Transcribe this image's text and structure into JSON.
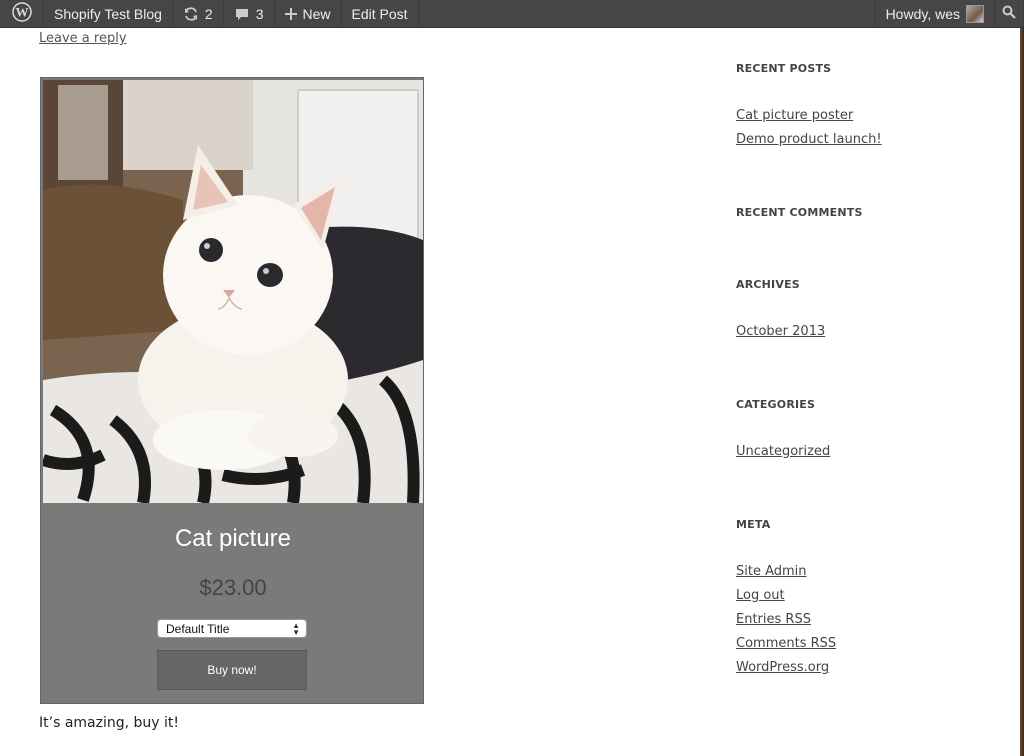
{
  "adminbar": {
    "site_name": "Shopify Test Blog",
    "updates_count": "2",
    "comments_count": "3",
    "new_label": "New",
    "edit_post_label": "Edit Post",
    "howdy_label": "Howdy, wes"
  },
  "post": {
    "leave_reply": "Leave a reply",
    "body_text": "It’s amazing, buy it!"
  },
  "product": {
    "title": "Cat picture",
    "price": "$23.00",
    "variant_selected": "Default Title",
    "buy_label": "Buy now!"
  },
  "sidebar": {
    "recent_posts": {
      "title": "RECENT POSTS",
      "items": [
        "Cat picture poster",
        "Demo product launch!"
      ]
    },
    "recent_comments": {
      "title": "RECENT COMMENTS"
    },
    "archives": {
      "title": "ARCHIVES",
      "items": [
        "October 2013"
      ]
    },
    "categories": {
      "title": "CATEGORIES",
      "items": [
        "Uncategorized"
      ]
    },
    "meta": {
      "title": "META",
      "items": [
        "Site Admin",
        "Log out",
        "Entries RSS",
        "Comments RSS",
        "WordPress.org"
      ]
    }
  },
  "colors": {
    "adminbar_bg": "#464646",
    "card_bg": "#7a7a7a",
    "buy_button_bg": "#666666"
  },
  "icons": [
    "wordpress-logo-icon",
    "updates-icon",
    "comment-bubble-icon",
    "plus-icon",
    "search-icon"
  ]
}
